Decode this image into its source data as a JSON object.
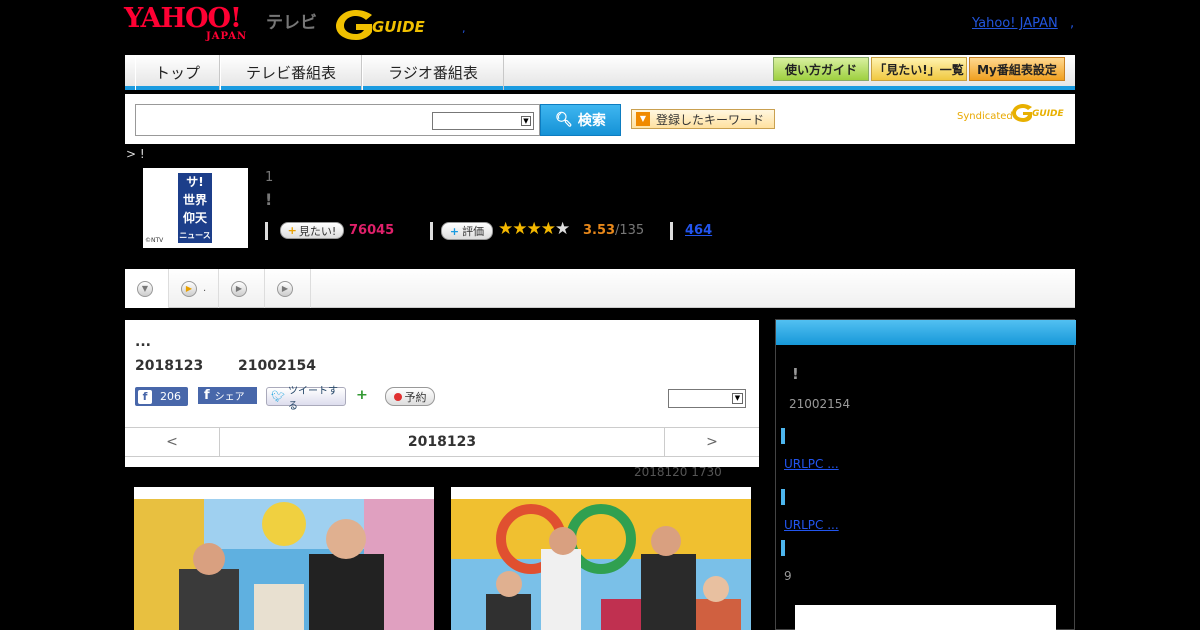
{
  "header": {
    "yahoo_logo": "YAHOO!",
    "yahoo_sub": "JAPAN",
    "tv_label": "テレビ",
    "gguide_logo": "GUIDE",
    "top_link": "Yahoo! JAPAN",
    "top_link_sep": ",",
    "dot": ","
  },
  "nav": {
    "tabs": [
      "トップ",
      "テレビ番組表",
      "ラジオ番組表"
    ],
    "right_buttons": [
      "使い方ガイド",
      "「見たい!」一覧",
      "My番組表設定"
    ]
  },
  "search": {
    "placeholder": "",
    "button_label": "検索",
    "keyword_button": "登録したキーワード",
    "syndicated": "Syndicated",
    "syndicated_logo": "GUIDE"
  },
  "breadcrumb": "> !",
  "program": {
    "image_text": [
      "サ!",
      "世界",
      "仰天",
      "ニュース"
    ],
    "image_credit": "©NTV",
    "episode": "1",
    "title": "!",
    "mitai_label": "見たい!",
    "mitai_count": "76045",
    "hyoka_label": "評価",
    "stars_on": "★★★★",
    "stars_off": "★",
    "rating": "3.53",
    "rating_count": "/135",
    "link_count": "464"
  },
  "tabs_bar": {
    "tab2_text": "."
  },
  "main": {
    "title": "...",
    "date": "2018123",
    "time": "21002154",
    "fb_like_count": "206",
    "fb_share": "シェア",
    "tweet": "ツイートする",
    "reserve": "予約",
    "date_nav": {
      "prev": "<",
      "current": "2018123",
      "next": ">"
    },
    "updated": "2018120  1730"
  },
  "sidebar": {
    "title": "!",
    "time": "21002154",
    "link1": "URLPC ...",
    "link2": "URLPC ...",
    "number": "9"
  },
  "colors": {
    "yahoo_red": "#ff0033",
    "accent_blue": "#1a9be0",
    "mitai_pink": "#e0206a",
    "rating_orange": "#e8881a",
    "link_blue": "#2255ee"
  }
}
